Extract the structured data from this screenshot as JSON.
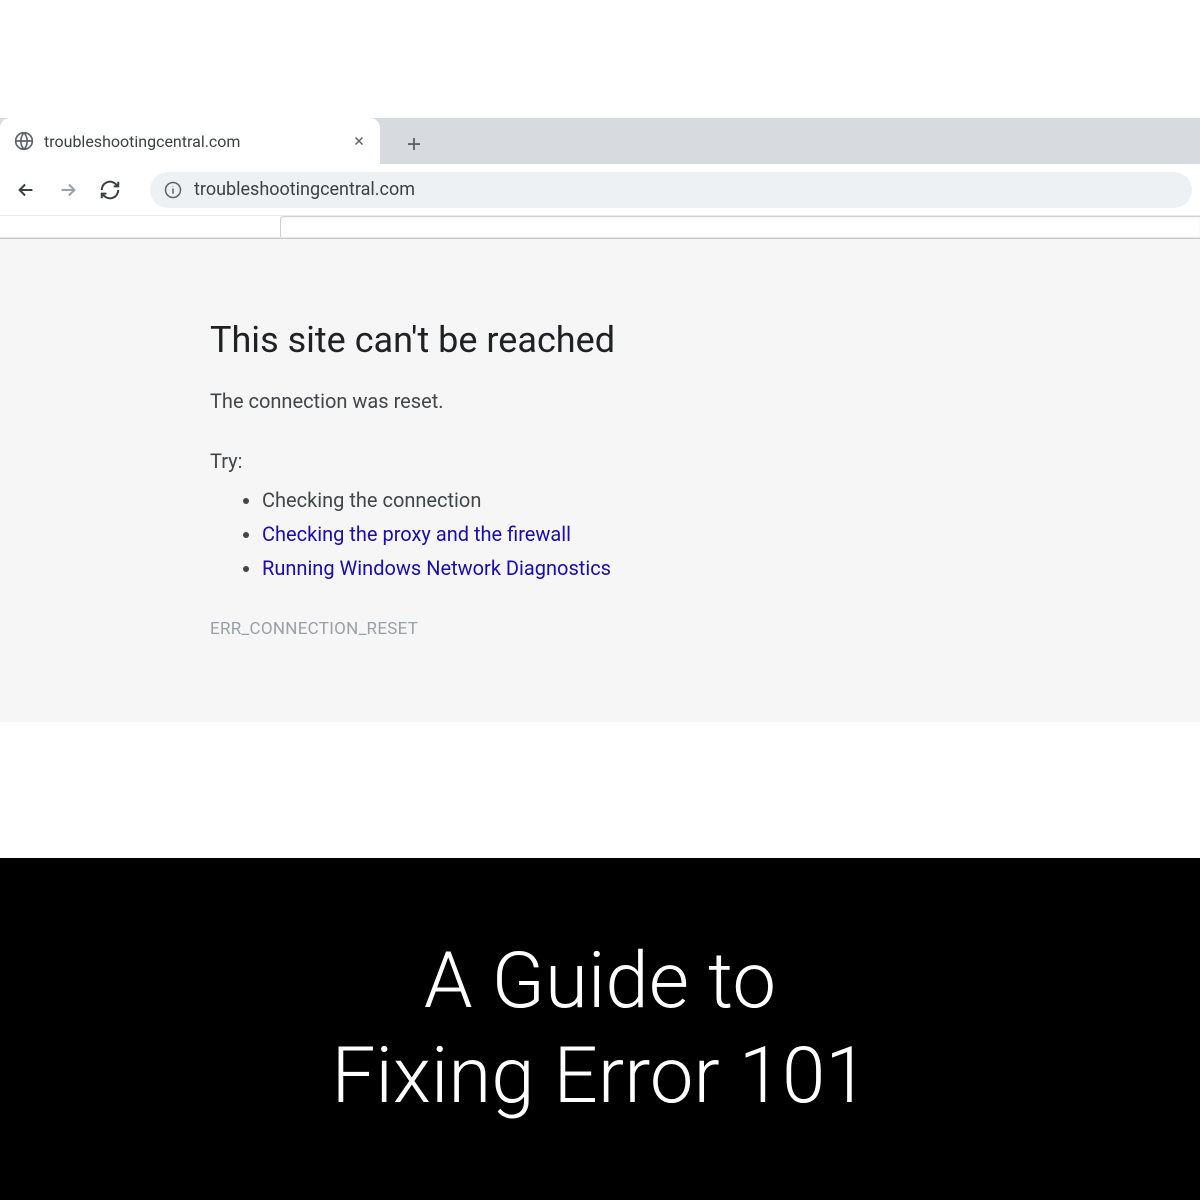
{
  "tab": {
    "title": "troubleshootingcentral.com"
  },
  "omnibox": {
    "url": "troubleshootingcentral.com"
  },
  "error": {
    "title": "This site can't be reached",
    "subtitle": "The connection was reset.",
    "tryLabel": "Try:",
    "suggestions": {
      "check_connection": "Checking the connection",
      "check_proxy": "Checking the proxy and the firewall",
      "run_diagnostics": "Running Windows Network Diagnostics"
    },
    "code": "ERR_CONNECTION_RESET"
  },
  "banner": {
    "line1": "A Guide to",
    "line2": "Fixing Error 101"
  }
}
